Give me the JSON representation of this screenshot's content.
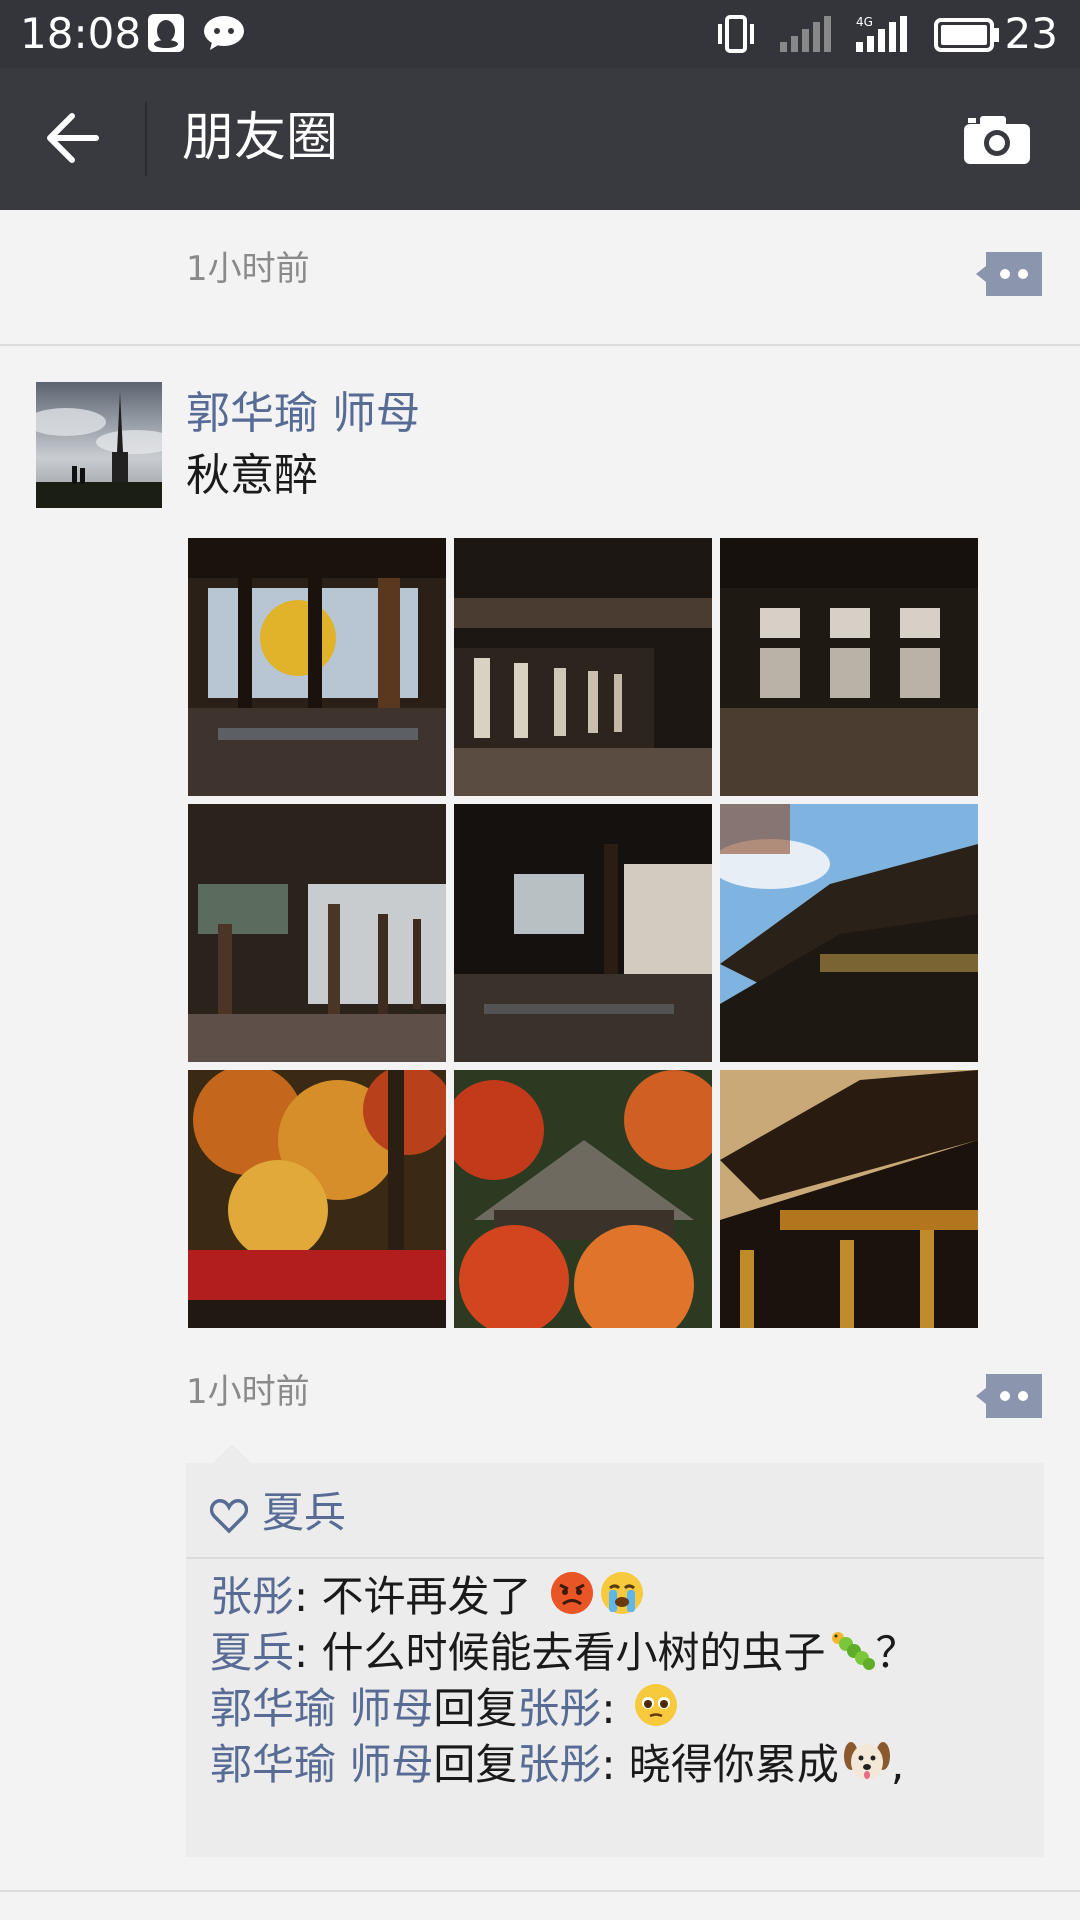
{
  "status_bar": {
    "time": "18:08",
    "battery": "23"
  },
  "nav": {
    "title": "朋友圈"
  },
  "previous_moment": {
    "time": "1小时前"
  },
  "post": {
    "author": "郭华瑜  师母",
    "text": "秋意醉",
    "time": "1小时前",
    "photos": [
      {
        "name": "temple-hall-window-yellow-tree"
      },
      {
        "name": "temple-corridor-dark"
      },
      {
        "name": "temple-hall-lattice-windows"
      },
      {
        "name": "temple-veranda-pillars"
      },
      {
        "name": "temple-long-hallway"
      },
      {
        "name": "pagoda-roof-blue-sky"
      },
      {
        "name": "autumn-maple-trees"
      },
      {
        "name": "temple-roof-red-maples"
      },
      {
        "name": "temple-eaves-sunset"
      }
    ],
    "likes": {
      "names": "夏兵"
    },
    "comments": [
      {
        "from": "张彤",
        "text": ": 不许再发了",
        "emoji": [
          "angry-face",
          "crying-face"
        ]
      },
      {
        "from": "夏兵",
        "text": ": 什么时候能去看小树的虫子",
        "emoji": [
          "caterpillar"
        ],
        "suffix": "？"
      },
      {
        "from": "郭华瑜  师母",
        "reply_word": "回复",
        "to": "张彤",
        "text": ": ",
        "emoji": [
          "pleading-face"
        ]
      },
      {
        "from": "郭华瑜  师母",
        "reply_word": "回复",
        "to": "张彤",
        "text": ": 晓得你累成",
        "emoji": [
          "dog-face"
        ],
        "suffix": ","
      }
    ]
  },
  "colors": {
    "nav_bg": "#393a3f",
    "status_bg": "#33353b",
    "name_link": "#576b95",
    "page_bg": "#f3f3f3",
    "comment_bg": "#ececec"
  }
}
